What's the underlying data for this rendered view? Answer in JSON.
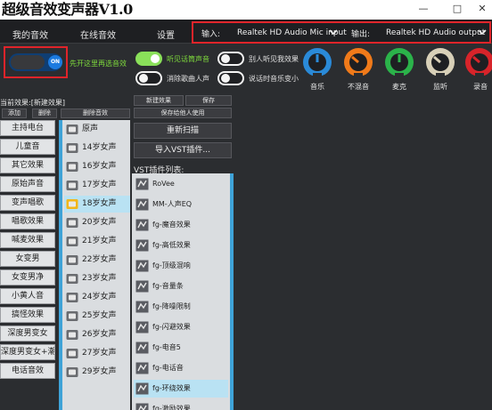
{
  "app": {
    "title": "超级音效变声器V1.0"
  },
  "window_controls": {
    "minimize": "—",
    "maximize": "□",
    "close": "✕"
  },
  "nav": [
    "我的音效",
    "在线音效",
    "设置"
  ],
  "io": {
    "input_label": "输入:",
    "input_value": "Realtek HD Audio Mic input",
    "output_label": "输出:",
    "output_value": "Realtek HD Audio output"
  },
  "main_toggle": {
    "state": "ON",
    "hint": "先开这里再选音效"
  },
  "toggles": [
    {
      "label": "听见话筒声音",
      "on": true
    },
    {
      "label": "消除歌曲人声",
      "on": false
    },
    {
      "label": "别人听见我效果",
      "on": false
    },
    {
      "label": "说话时音乐变小",
      "on": false
    }
  ],
  "dials": [
    {
      "label": "音乐",
      "color": "#2a8ad8",
      "icon": "music-dial-icon"
    },
    {
      "label": "不混音",
      "color": "#f07a1a",
      "icon": "nomix-dial-icon"
    },
    {
      "label": "麦克",
      "color": "#2bb34a",
      "icon": "mic-dial-icon"
    },
    {
      "label": "监听",
      "color": "#d8d0b8",
      "icon": "monitor-dial-icon"
    },
    {
      "label": "录音",
      "color": "#d8242a",
      "icon": "record-dial-icon"
    }
  ],
  "left_panel": {
    "title": "当前效果:[新建效果]",
    "add_label": "添加",
    "delete_label": "删除",
    "delete_effect_label": "删除音效"
  },
  "categories": [
    "主持电台",
    "儿童音",
    "其它效果",
    "原始声音",
    "变声唱歌",
    "唱歌效果",
    "喊麦效果",
    "女变男",
    "女变男净",
    "小黄人音",
    "搞怪效果",
    "深度男变女",
    "深度男变女+潮响",
    "电话音效"
  ],
  "effects": {
    "selected": "18岁女声",
    "items": [
      "原声",
      "14岁女声",
      "16岁女声",
      "17岁女声",
      "18岁女声",
      "20岁女声",
      "21岁女声",
      "22岁女声",
      "23岁女声",
      "24岁女声",
      "25岁女声",
      "26岁女声",
      "27岁女声",
      "29岁女声"
    ]
  },
  "vst": {
    "new_effect": "新建效果",
    "save": "保存",
    "save_for_others": "保存给他人使用",
    "rescan": "重新扫描",
    "import": "导入VST插件...",
    "list_title": "VST插件列表:",
    "selected": "fg-环绕效果",
    "items": [
      "RoVee",
      "MM-人声EQ",
      "fg-魔音效果",
      "fg-高低效果",
      "fg-顶级混响",
      "fg-音量条",
      "fg-降噪限制",
      "fg-闪避效果",
      "fg-电音5",
      "fg-电话音",
      "fg-环绕效果",
      "fg-激励效果"
    ]
  }
}
